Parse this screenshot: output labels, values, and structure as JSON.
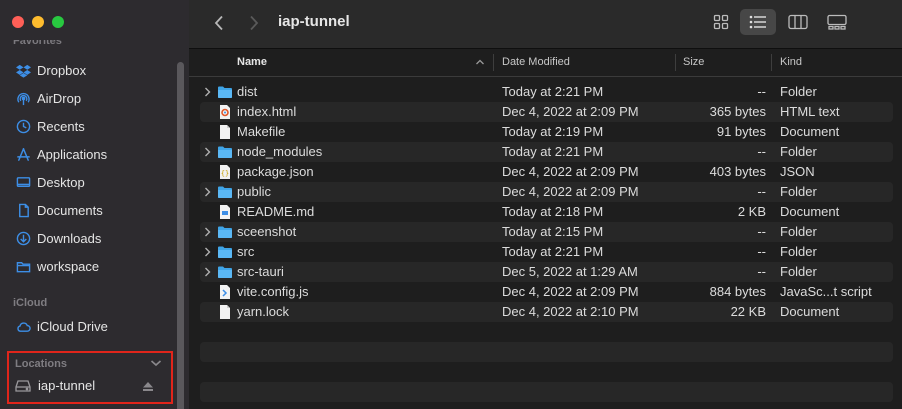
{
  "window": {
    "title": "iap-tunnel"
  },
  "sidebar": {
    "favorites_header": "Favorites",
    "favorites": [
      {
        "label": "Dropbox",
        "icon": "dropbox-icon"
      },
      {
        "label": "AirDrop",
        "icon": "airdrop-icon"
      },
      {
        "label": "Recents",
        "icon": "clock-icon"
      },
      {
        "label": "Applications",
        "icon": "applications-icon"
      },
      {
        "label": "Desktop",
        "icon": "desktop-icon"
      },
      {
        "label": "Documents",
        "icon": "document-icon"
      },
      {
        "label": "Downloads",
        "icon": "download-icon"
      },
      {
        "label": "workspace",
        "icon": "folder-icon"
      }
    ],
    "icloud_header": "iCloud",
    "icloud": [
      {
        "label": "iCloud Drive",
        "icon": "cloud-icon"
      }
    ],
    "locations_header": "Locations",
    "locations": [
      {
        "label": "iap-tunnel",
        "icon": "drive-icon"
      }
    ]
  },
  "columns": {
    "name": "Name",
    "date": "Date Modified",
    "size": "Size",
    "kind": "Kind"
  },
  "files": [
    {
      "name": "dist",
      "date": "Today at 2:21 PM",
      "size": "--",
      "kind": "Folder",
      "type": "folder"
    },
    {
      "name": "index.html",
      "date": "Dec 4, 2022 at 2:09 PM",
      "size": "365 bytes",
      "kind": "HTML text",
      "type": "html"
    },
    {
      "name": "Makefile",
      "date": "Today at 2:19 PM",
      "size": "91 bytes",
      "kind": "Document",
      "type": "doc"
    },
    {
      "name": "node_modules",
      "date": "Today at 2:21 PM",
      "size": "--",
      "kind": "Folder",
      "type": "folder"
    },
    {
      "name": "package.json",
      "date": "Dec 4, 2022 at 2:09 PM",
      "size": "403 bytes",
      "kind": "JSON",
      "type": "json"
    },
    {
      "name": "public",
      "date": "Dec 4, 2022 at 2:09 PM",
      "size": "--",
      "kind": "Folder",
      "type": "folder"
    },
    {
      "name": "README.md",
      "date": "Today at 2:18 PM",
      "size": "2 KB",
      "kind": "Document",
      "type": "md"
    },
    {
      "name": "sceenshot",
      "date": "Today at 2:15 PM",
      "size": "--",
      "kind": "Folder",
      "type": "folder"
    },
    {
      "name": "src",
      "date": "Today at 2:21 PM",
      "size": "--",
      "kind": "Folder",
      "type": "folder"
    },
    {
      "name": "src-tauri",
      "date": "Dec 5, 2022 at 1:29 AM",
      "size": "--",
      "kind": "Folder",
      "type": "folder"
    },
    {
      "name": "vite.config.js",
      "date": "Dec 4, 2022 at 2:09 PM",
      "size": "884 bytes",
      "kind": "JavaSc...t script",
      "type": "js"
    },
    {
      "name": "yarn.lock",
      "date": "Dec 4, 2022 at 2:10 PM",
      "size": "22 KB",
      "kind": "Document",
      "type": "doc"
    }
  ],
  "colors": {
    "folder": "#3fa4e6",
    "accent": "#3d8ee6",
    "highlight_box": "#e0251b"
  }
}
